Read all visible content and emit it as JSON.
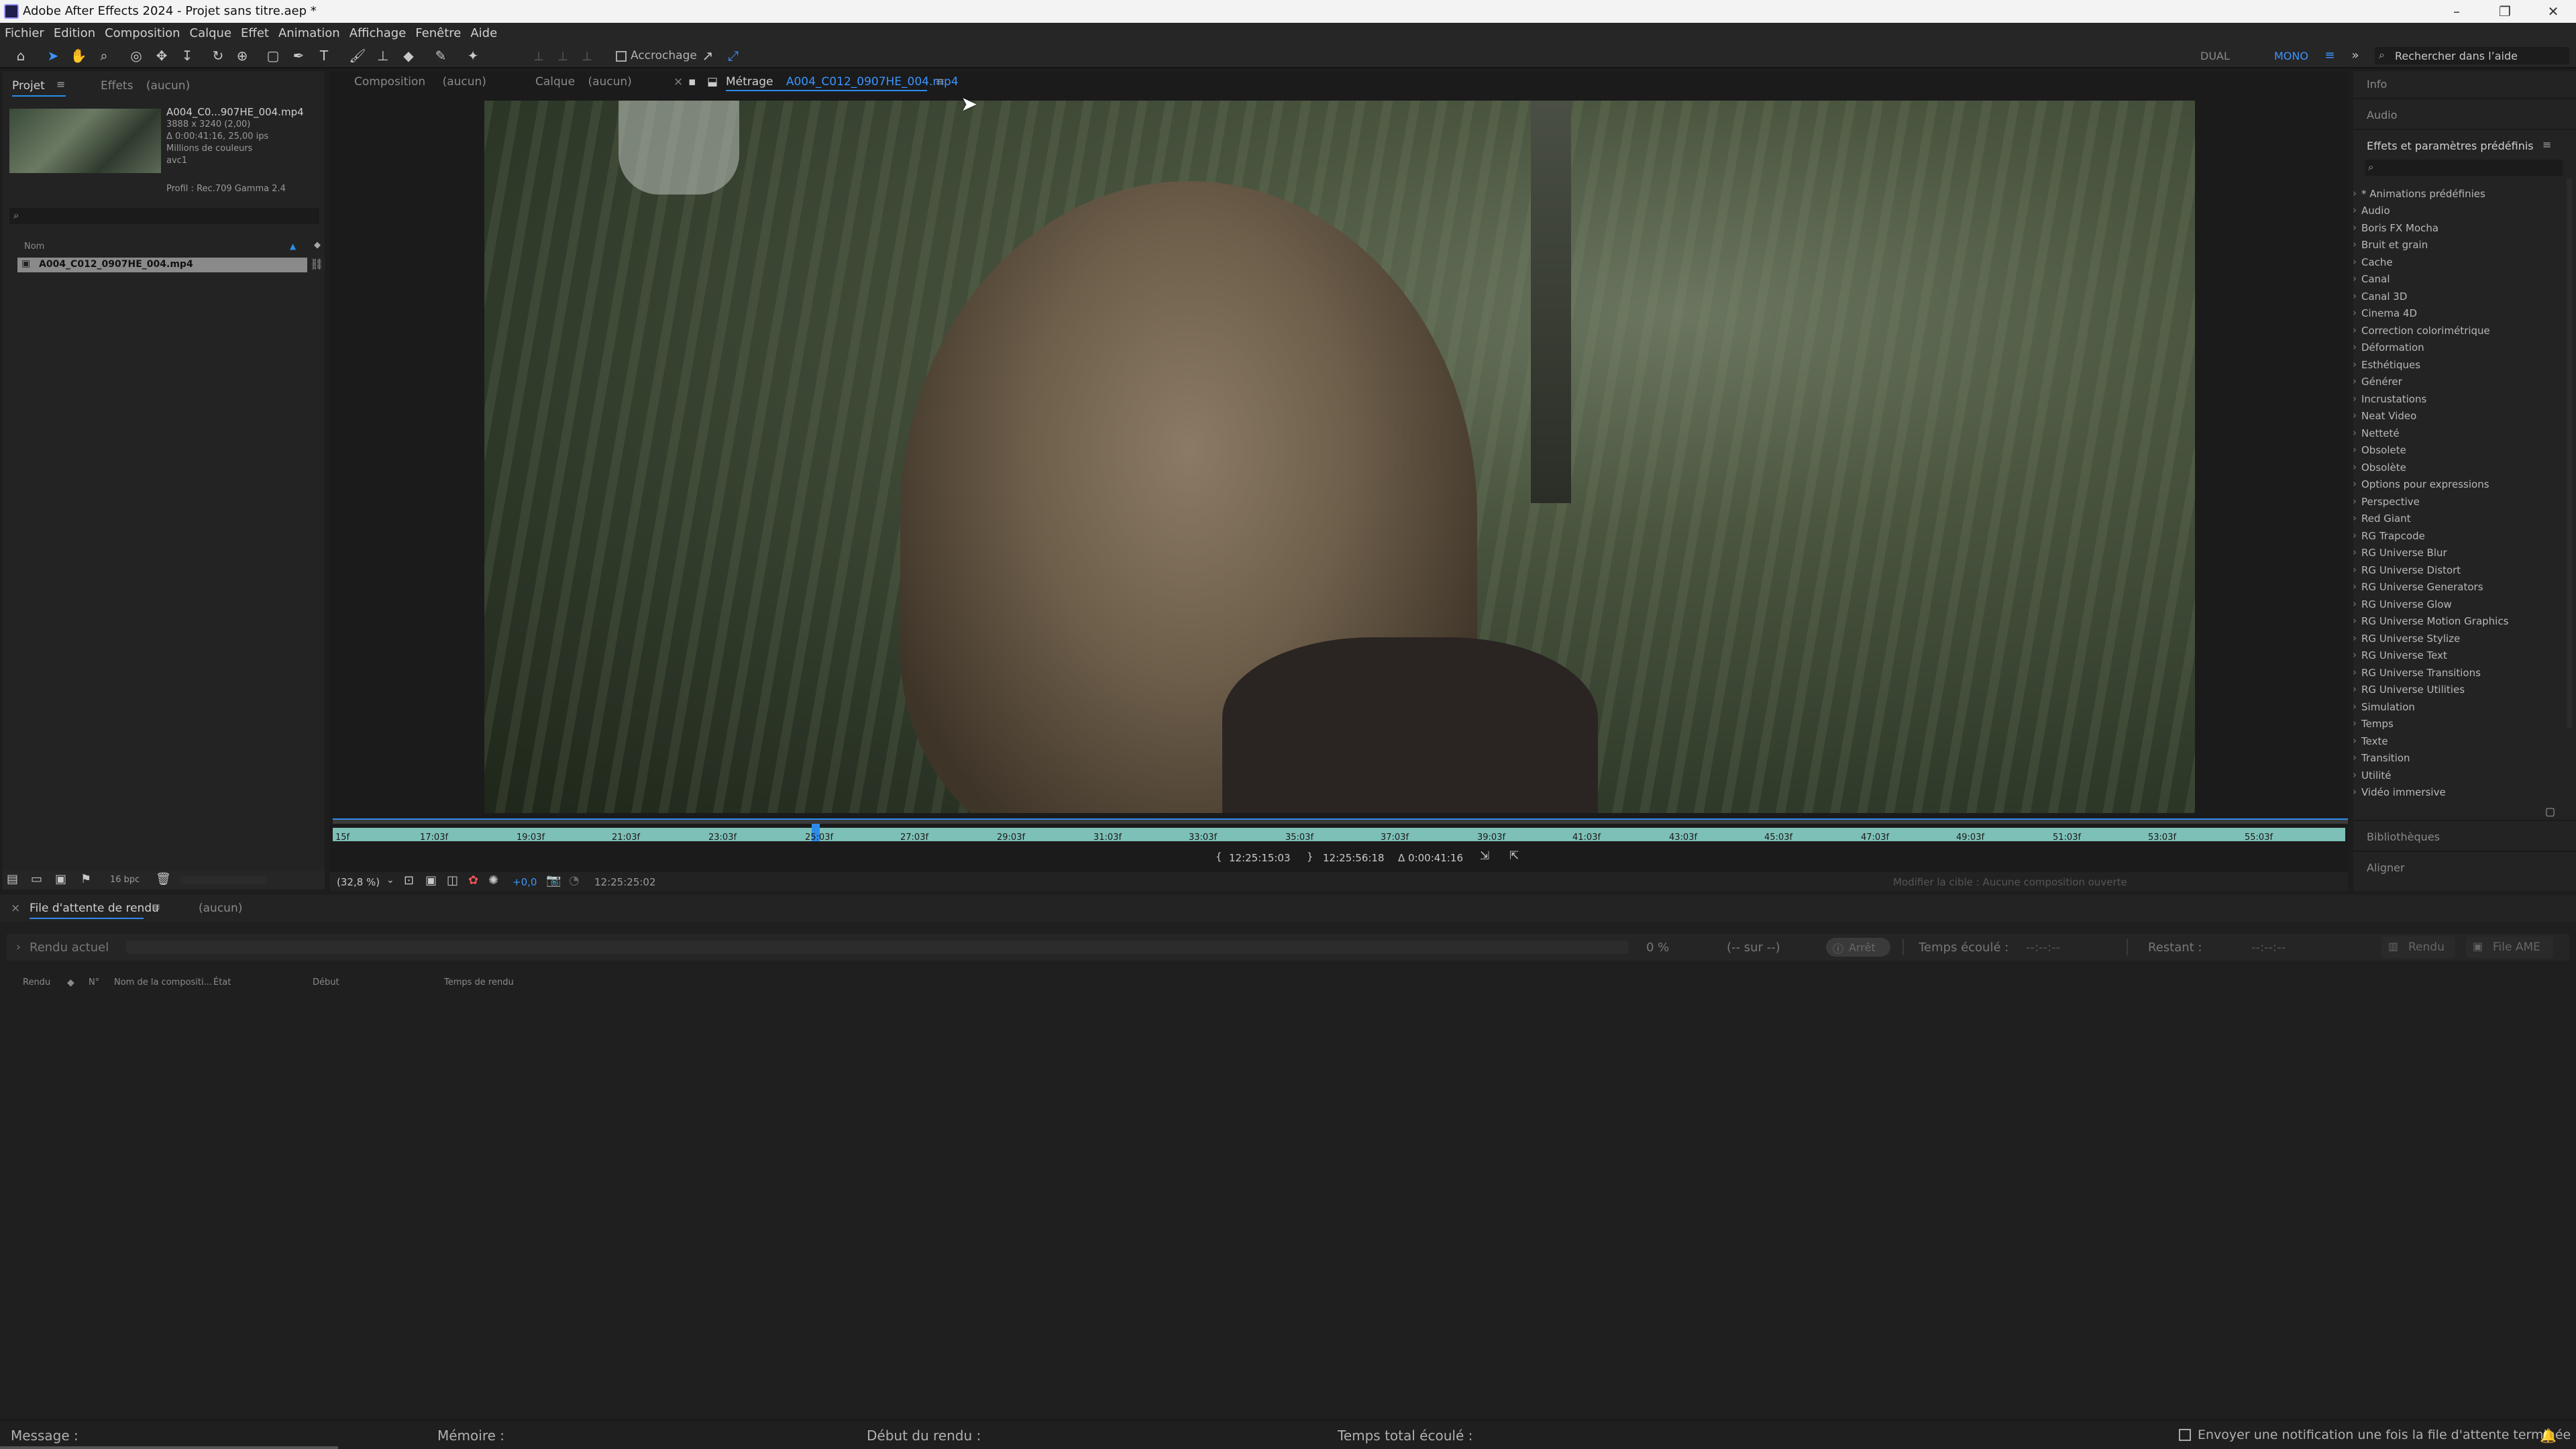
{
  "window": {
    "title": "Adobe After Effects 2024 - Projet sans titre.aep *"
  },
  "menu": [
    "Fichier",
    "Edition",
    "Composition",
    "Calque",
    "Effet",
    "Animation",
    "Affichage",
    "Fenêtre",
    "Aide"
  ],
  "toolbar": {
    "snapping_label": "Accrochage",
    "workspace_dual": "DUAL",
    "workspace_mono": "MONO",
    "search_help": "Rechercher dans l’aide"
  },
  "project_panel": {
    "tab_project": "Projet",
    "tab_effects": "Effets",
    "tab_effects_value": "(aucun)",
    "file_name_short": "A004_C0...907HE_004.mp4",
    "file_res": "3888 x 3240 (2,00)",
    "file_duration": "Δ 0:00:41:16, 25,00 ips",
    "file_colors": "Millions de couleurs",
    "file_codec": "avc1",
    "profile": "Profil : Rec.709 Gamma 2.4",
    "column_name": "Nom",
    "item_name": "A004_C012_0907HE_004.mp4",
    "bpc": "16 bpc"
  },
  "viewer": {
    "tab_composition": "Composition",
    "tab_composition_value": "(aucun)",
    "tab_layer": "Calque",
    "tab_layer_value": "(aucun)",
    "tab_footage": "Métrage",
    "tab_footage_value": "A004_C012_0907HE_004.mp4",
    "ticks": [
      "15f",
      "17:03f",
      "19:03f",
      "21:03f",
      "23:03f",
      "25:03f",
      "27:03f",
      "29:03f",
      "31:03f",
      "33:03f",
      "35:03f",
      "37:03f",
      "39:03f",
      "41:03f",
      "43:03f",
      "45:03f",
      "47:03f",
      "49:03f",
      "51:03f",
      "53:03f",
      "55:03f"
    ],
    "in_point": "12:25:15:03",
    "out_point": "12:25:56:18",
    "duration": "Δ 0:00:41:16",
    "zoom": "(32,8 %)",
    "exposure": "+0,0",
    "timecode": "12:25:25:02",
    "edit_hint": "Modifier la cible : Aucune composition ouverte"
  },
  "right_panel": {
    "info": "Info",
    "audio": "Audio",
    "effects_title": "Effets et paramètres prédéfinis",
    "effects": [
      "* Animations prédéfinies",
      "Audio",
      "Boris FX Mocha",
      "Bruit et grain",
      "Cache",
      "Canal",
      "Canal 3D",
      "Cinema 4D",
      "Correction colorimétrique",
      "Déformation",
      "Esthétiques",
      "Générer",
      "Incrustations",
      "Neat Video",
      "Netteté",
      "Obsolete",
      "Obsolète",
      "Options pour expressions",
      "Perspective",
      "Red Giant",
      "RG Trapcode",
      "RG Universe Blur",
      "RG Universe Distort",
      "RG Universe Generators",
      "RG Universe Glow",
      "RG Universe Motion Graphics",
      "RG Universe Stylize",
      "RG Universe Text",
      "RG Universe Transitions",
      "RG Universe Utilities",
      "Simulation",
      "Temps",
      "Texte",
      "Transition",
      "Utilité",
      "Vidéo immersive"
    ],
    "libraries": "Bibliothèques",
    "align": "Aligner"
  },
  "render_queue": {
    "tab": "File d'attente de rendu",
    "tab_value": "(aucun)",
    "current_render": "Rendu actuel",
    "percent": "0 %",
    "of": "(-- sur --)",
    "stop": "Arrêt",
    "elapsed_label": "Temps écoulé :",
    "elapsed_value": "--:--:--",
    "remaining_label": "Restant :",
    "remaining_value": "--:--:--",
    "render_btn": "Rendu",
    "ame_btn": "File AME",
    "col_render": "Rendu",
    "col_num": "N°",
    "col_comp": "Nom de la compositi...",
    "col_state": "État",
    "col_start": "Début",
    "col_time": "Temps de rendu"
  },
  "footer": {
    "message": "Message :",
    "memory": "Mémoire :",
    "render_start": "Début du rendu :",
    "total_elapsed": "Temps total écoulé :",
    "notify": "Envoyer une notification une fois la file d'attente terminée"
  },
  "colors": {
    "accent": "#2d8ceb",
    "timeline_bar": "#7dc0b7",
    "panel_bg": "#232323",
    "app_bg": "#1d1d1d"
  }
}
